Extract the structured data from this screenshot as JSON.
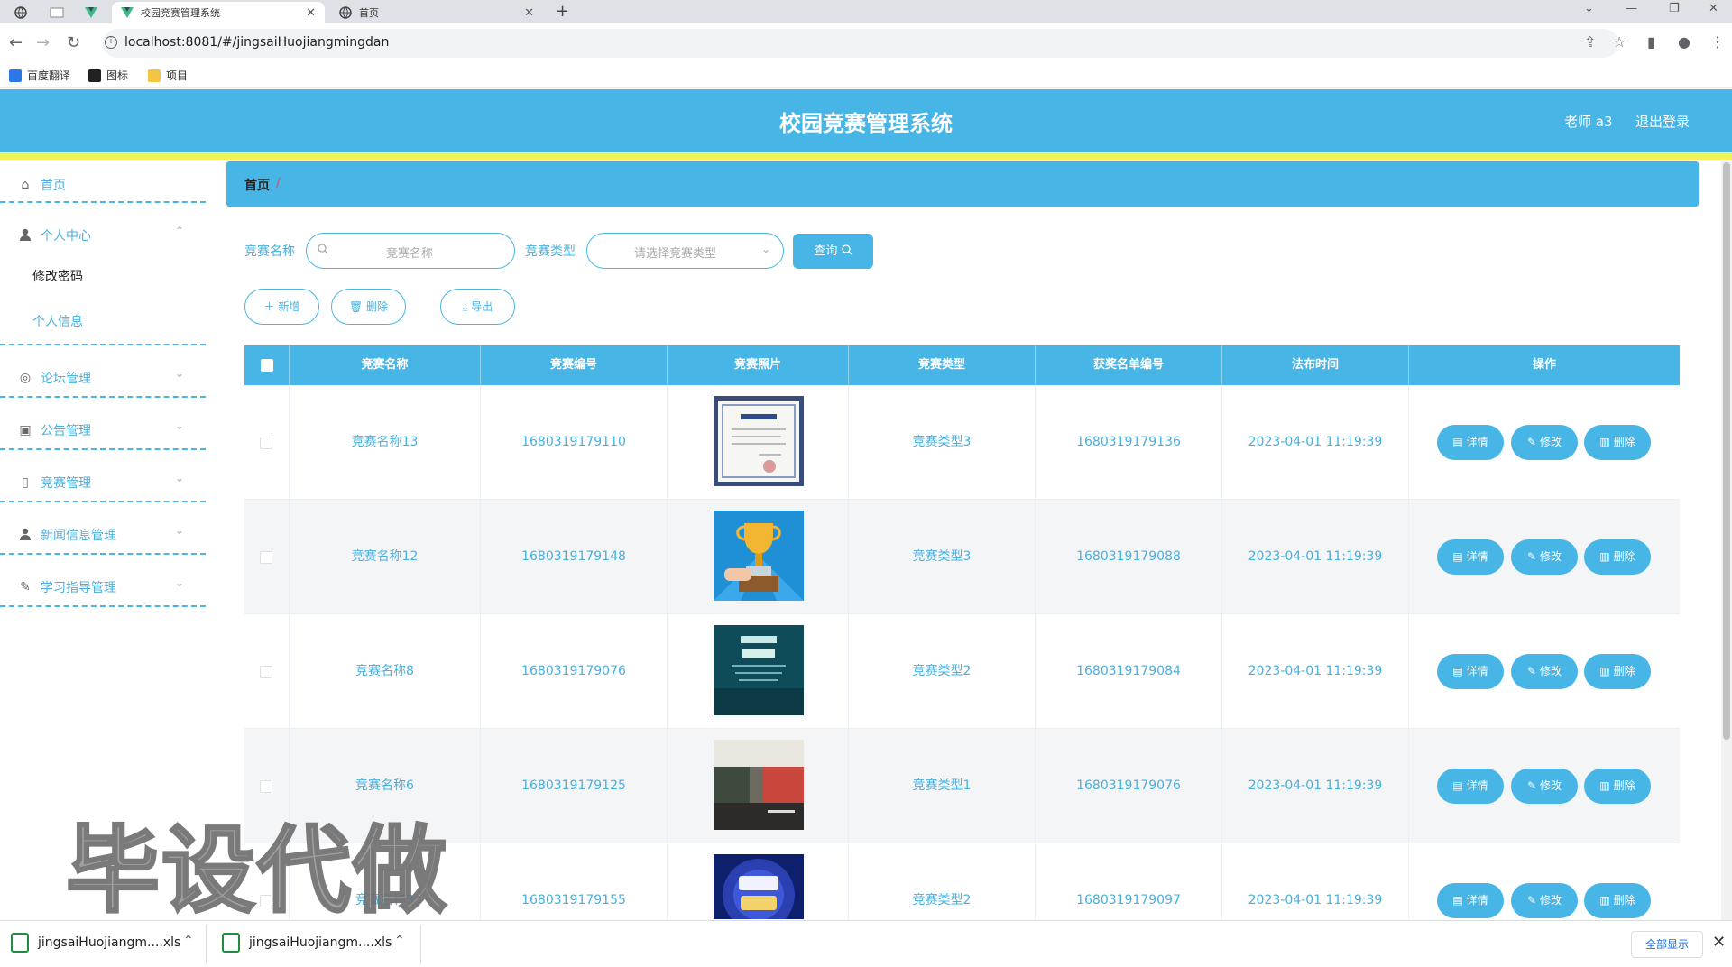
{
  "browser": {
    "tabs": [
      {
        "title": "校园竞赛管理系统",
        "active": true
      },
      {
        "title": "首页",
        "active": false
      }
    ],
    "url": "localhost:8081/#/jingsaiHuojiangmingdan",
    "bookmarks": [
      "百度翻译",
      "图标",
      "项目"
    ]
  },
  "header": {
    "title": "校园竞赛管理系统",
    "user": "老师 a3",
    "logout": "退出登录"
  },
  "sidebar": {
    "items": [
      {
        "label": "首页",
        "icon": "home-icon",
        "arrow": ""
      },
      {
        "label": "个人中心",
        "icon": "user-icon",
        "arrow": "⌃"
      },
      {
        "label": "论坛管理",
        "icon": "forum-icon",
        "arrow": "⌄"
      },
      {
        "label": "公告管理",
        "icon": "notice-icon",
        "arrow": "⌄"
      },
      {
        "label": "竞赛管理",
        "icon": "trophy-icon",
        "arrow": "⌄"
      },
      {
        "label": "新闻信息管理",
        "icon": "news-icon",
        "arrow": "⌄"
      },
      {
        "label": "学习指导管理",
        "icon": "study-icon",
        "arrow": "⌄"
      }
    ],
    "sub_items": [
      "修改密码",
      "个人信息"
    ]
  },
  "breadcrumb": {
    "home": "首页",
    "sep": "/"
  },
  "search": {
    "name_label": "竞赛名称",
    "name_placeholder": "竞赛名称",
    "type_label": "竞赛类型",
    "type_placeholder": "请选择竞赛类型",
    "query_button": "查询"
  },
  "actions": {
    "add": "新增",
    "delete": "删除",
    "export": "导出"
  },
  "table": {
    "columns": [
      "竞赛名称",
      "竞赛编号",
      "竞赛照片",
      "竞赛类型",
      "获奖名单编号",
      "法布时间",
      "操作"
    ],
    "rows": [
      {
        "name": "竞赛名称13",
        "code": "1680319179110",
        "type": "竞赛类型3",
        "award_no": "1680319179136",
        "time": "2023-04-01 11:19:39",
        "image": "certificate"
      },
      {
        "name": "竞赛名称12",
        "code": "1680319179148",
        "type": "竞赛类型3",
        "award_no": "1680319179088",
        "time": "2023-04-01 11:19:39",
        "image": "trophy"
      },
      {
        "name": "竞赛名称8",
        "code": "1680319179076",
        "type": "竞赛类型2",
        "award_no": "1680319179084",
        "time": "2023-04-01 11:19:39",
        "image": "poster"
      },
      {
        "name": "竞赛名称6",
        "code": "1680319179125",
        "type": "竞赛类型1",
        "award_no": "1680319179076",
        "time": "2023-04-01 11:19:39",
        "image": "hall"
      },
      {
        "name": "竞赛名称3",
        "code": "1680319179155",
        "type": "竞赛类型2",
        "award_no": "1680319179097",
        "time": "2023-04-01 11:19:39",
        "image": "knowledge"
      }
    ],
    "op_labels": {
      "detail": "详情",
      "edit": "修改",
      "delete": "删除"
    }
  },
  "watermark": "毕设代做",
  "downloads": {
    "files": [
      "jingsaiHuojiangm....xls",
      "jingsaiHuojiangm....xls"
    ],
    "show_all": "全部显示"
  },
  "colors": {
    "primary": "#47b5e5",
    "accent_yellow": "#f2f25a",
    "link": "#49b0dd"
  }
}
